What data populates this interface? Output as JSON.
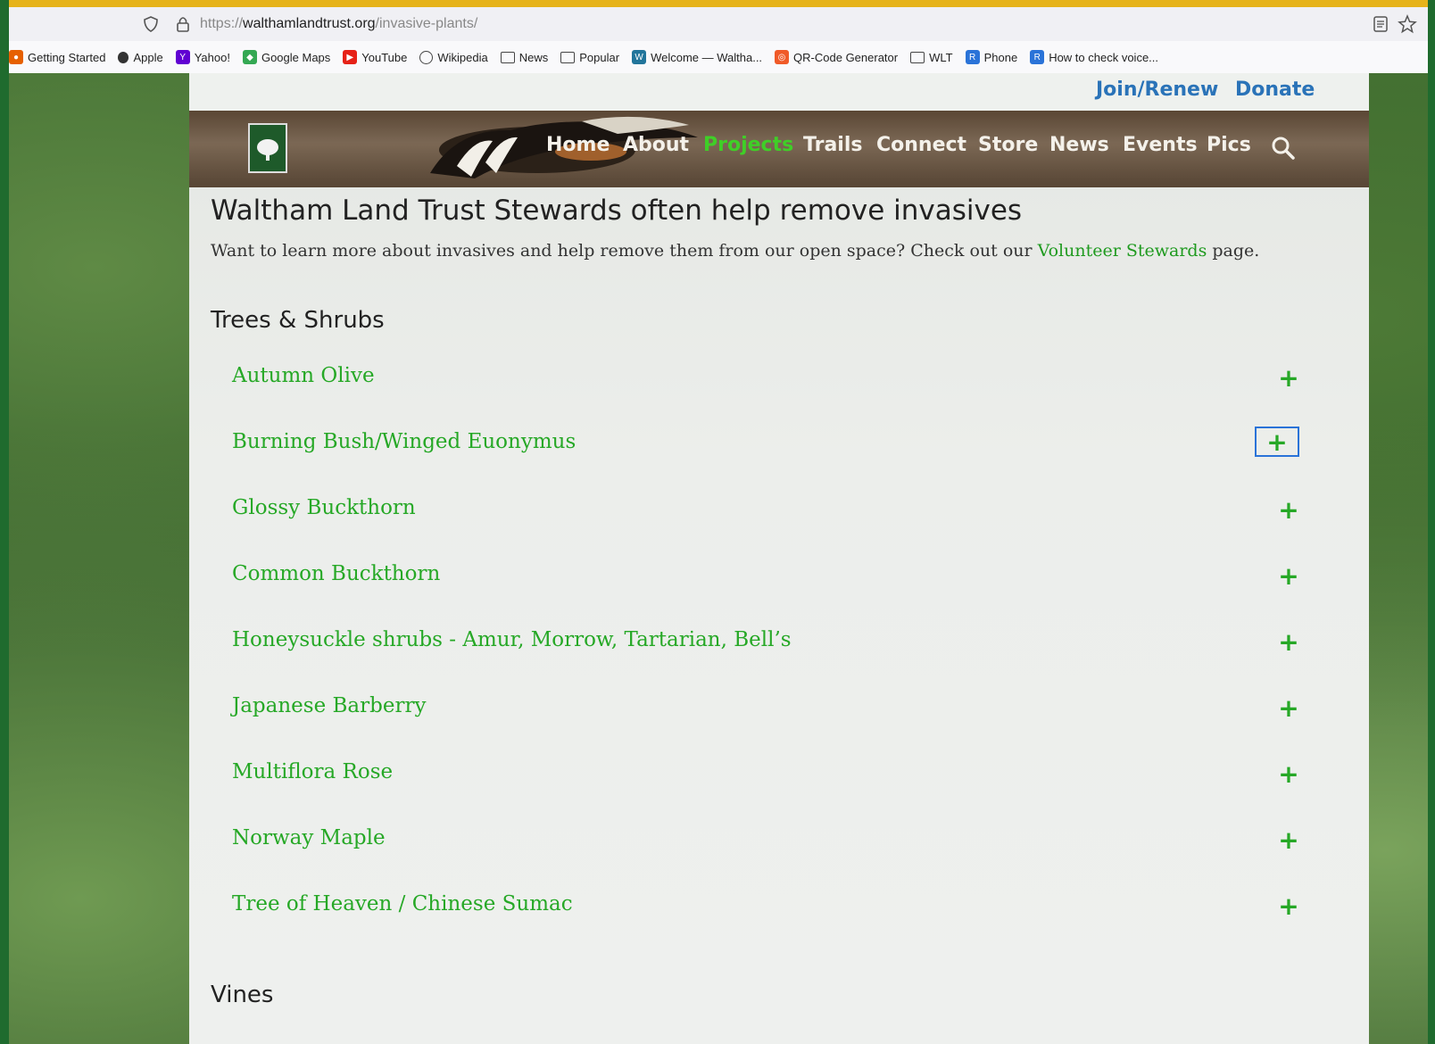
{
  "browser": {
    "url_scheme": "https://",
    "url_host": "walthamlandtrust.org",
    "url_path": "/invasive-plants/",
    "bookmarks": [
      {
        "label": "Getting Started",
        "icon": "firefox-icon"
      },
      {
        "label": "Apple",
        "icon": "apple-icon"
      },
      {
        "label": "Yahoo!",
        "icon": "yahoo-icon"
      },
      {
        "label": "Google Maps",
        "icon": "maps-icon"
      },
      {
        "label": "YouTube",
        "icon": "youtube-icon"
      },
      {
        "label": "Wikipedia",
        "icon": "globe-icon"
      },
      {
        "label": "News",
        "icon": "folder-icon"
      },
      {
        "label": "Popular",
        "icon": "folder-icon"
      },
      {
        "label": "Welcome — Waltha...",
        "icon": "wordpress-icon"
      },
      {
        "label": "QR-Code Generator",
        "icon": "qr-icon"
      },
      {
        "label": "WLT",
        "icon": "folder-icon"
      },
      {
        "label": "Phone",
        "icon": "r-icon"
      },
      {
        "label": "How to check voice...",
        "icon": "r-icon"
      }
    ]
  },
  "site": {
    "top_links": {
      "join": "Join/Renew",
      "donate": "Donate"
    },
    "nav": [
      "Home",
      "About",
      "Projects",
      "Trails",
      "Connect",
      "Store",
      "News",
      "Events",
      "Pics"
    ],
    "active_nav": "Projects",
    "colors": {
      "accent_green": "#26a826",
      "nav_active": "#3fcf27",
      "link_blue": "#2a73b8"
    }
  },
  "main": {
    "title": "Waltham Land Trust Stewards often help remove invasives",
    "intro_prefix": "Want to learn more about invasives and help remove them from our open space? Check out our ",
    "intro_link": "Volunteer Stewards",
    "intro_suffix": " page.",
    "sections": [
      {
        "heading": "Trees & Shrubs",
        "items": [
          "Autumn Olive",
          "Burning Bush/Winged Euonymus",
          "Glossy Buckthorn",
          "Common Buckthorn",
          "Honeysuckle shrubs - Amur, Morrow, Tartarian, Bell’s",
          "Japanese Barberry",
          "Multiflora Rose",
          "Norway Maple",
          "Tree of Heaven / Chinese Sumac"
        ]
      },
      {
        "heading": "Vines",
        "items": []
      }
    ],
    "expand_symbol": "+"
  }
}
